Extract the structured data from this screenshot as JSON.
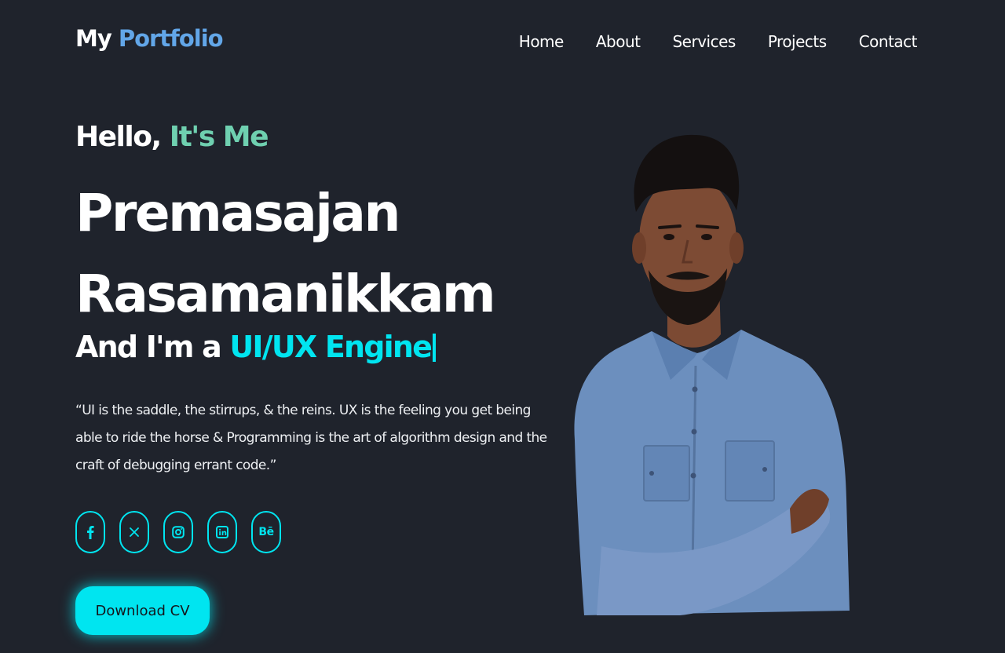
{
  "header": {
    "logo_prefix": "My",
    "logo_accent": "Portfolio",
    "nav": [
      "Home",
      "About",
      "Services",
      "Projects",
      "Contact"
    ]
  },
  "hero": {
    "greeting_prefix": "Hello,",
    "greeting_accent": "It's Me",
    "name_line1": "Premasajan",
    "name_line2": "Rasamanikkam",
    "role_prefix": "And I'm a",
    "role_accent": "UI/UX Engine",
    "quote": "“UI is the saddle, the stirrups, & the reins. UX is the feeling you get being able to ride the horse & Programming is the art of algorithm design and the craft of debugging errant code.”",
    "socials": [
      {
        "icon": "facebook-icon"
      },
      {
        "icon": "x-twitter-icon"
      },
      {
        "icon": "instagram-icon"
      },
      {
        "icon": "linkedin-icon"
      },
      {
        "icon": "behance-icon",
        "glyph": "Bē"
      }
    ],
    "download_label": "Download CV"
  },
  "colors": {
    "background": "#1f232c",
    "logo_accent": "#62a6e8",
    "greeting_accent": "#6fd0b0",
    "primary_accent": "#00e5f0",
    "text": "#ffffff"
  }
}
